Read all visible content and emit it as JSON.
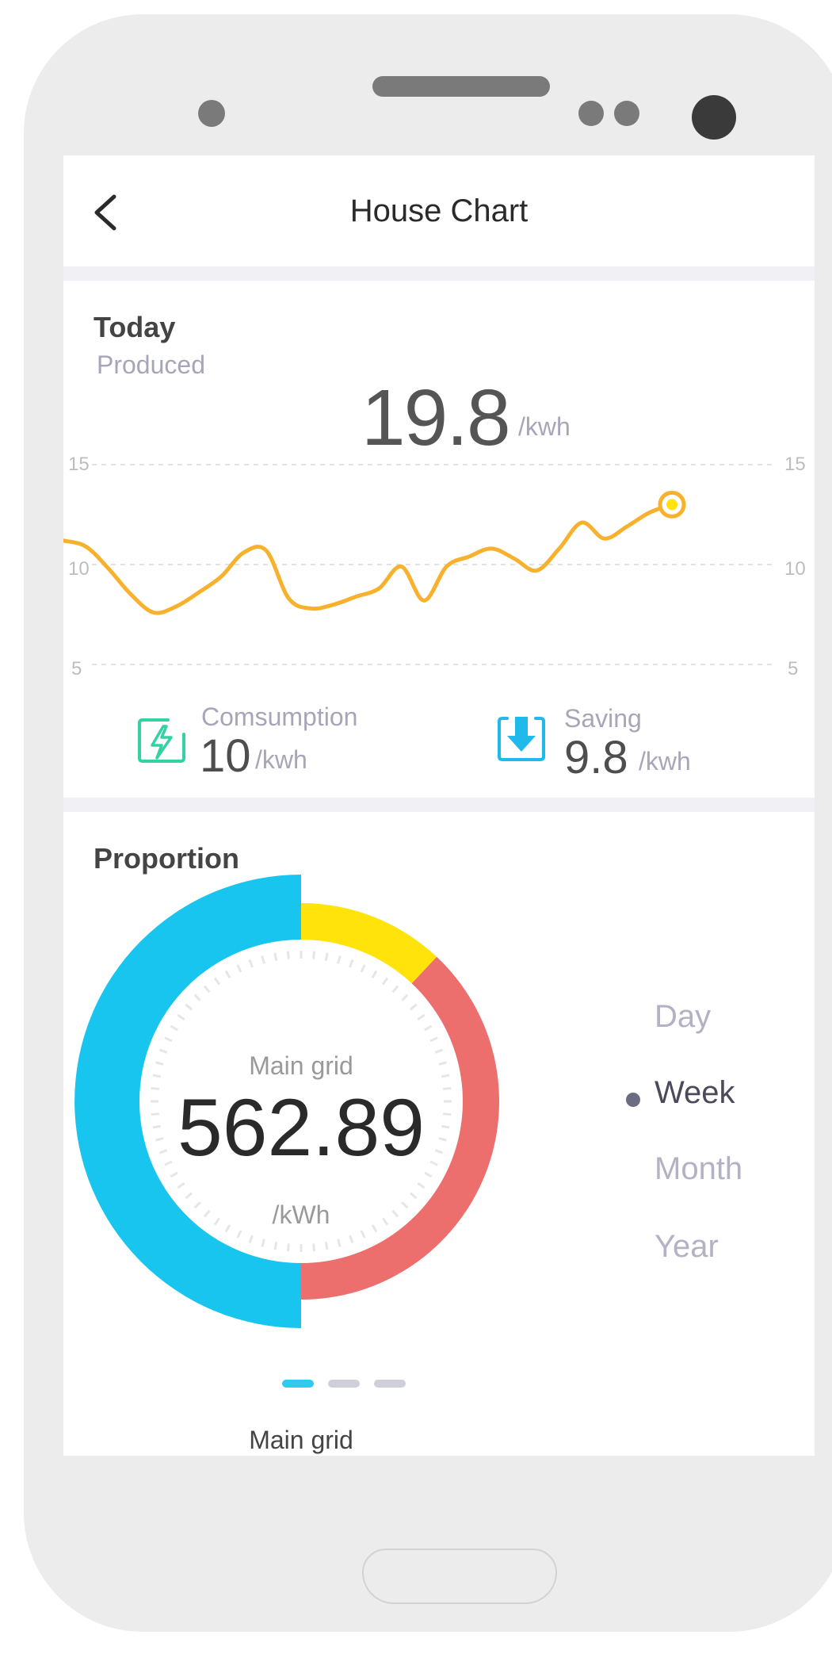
{
  "header": {
    "title": "House Chart",
    "back_icon": "chevron-left-icon"
  },
  "today": {
    "title": "Today",
    "produced_label": "Produced",
    "produced_value": "19.8",
    "produced_unit": "/kwh",
    "axis_ticks": [
      "15",
      "10",
      "5"
    ],
    "line_color": "#f7b12d",
    "consumption": {
      "label": "Comsumption",
      "value": "10",
      "unit": "/kwh",
      "icon": "charging-icon",
      "color": "#34d1a2"
    },
    "saving": {
      "label": "Saving",
      "value": "9.8",
      "unit": "/kwh",
      "icon": "download-arrow-icon",
      "color": "#1fb9ea"
    }
  },
  "chart_data": {
    "type": "line",
    "title": "",
    "xlabel": "",
    "ylabel": "",
    "ylim": [
      5,
      15
    ],
    "grid": true,
    "y_ticks": [
      15,
      10,
      5
    ],
    "series": [
      {
        "values": [
          11.2,
          10.9,
          9.8,
          8.5,
          7.6,
          7.9,
          8.6,
          9.4,
          10.6,
          10.7,
          8.3,
          7.8,
          8.0,
          8.4,
          8.8,
          9.9,
          8.2,
          9.9,
          10.4,
          10.8,
          10.3,
          9.7,
          10.8,
          12.1,
          11.3,
          11.9,
          12.6,
          13.0
        ]
      }
    ],
    "highlight_last": true
  },
  "proportion": {
    "title": "Proportion",
    "center_label": "Main grid",
    "center_value": "562.89",
    "center_unit": "/kWh",
    "segments": [
      {
        "value": 50,
        "color": "#17c5ef"
      },
      {
        "value": 12,
        "color": "#ffe30a"
      },
      {
        "value": 38,
        "color": "#ec6f6d"
      }
    ],
    "periods": [
      "Day",
      "Week",
      "Month",
      "Year"
    ],
    "active_period": "Week",
    "pager_count": 3,
    "pager_active": 0,
    "pager_caption": "Main grid"
  }
}
